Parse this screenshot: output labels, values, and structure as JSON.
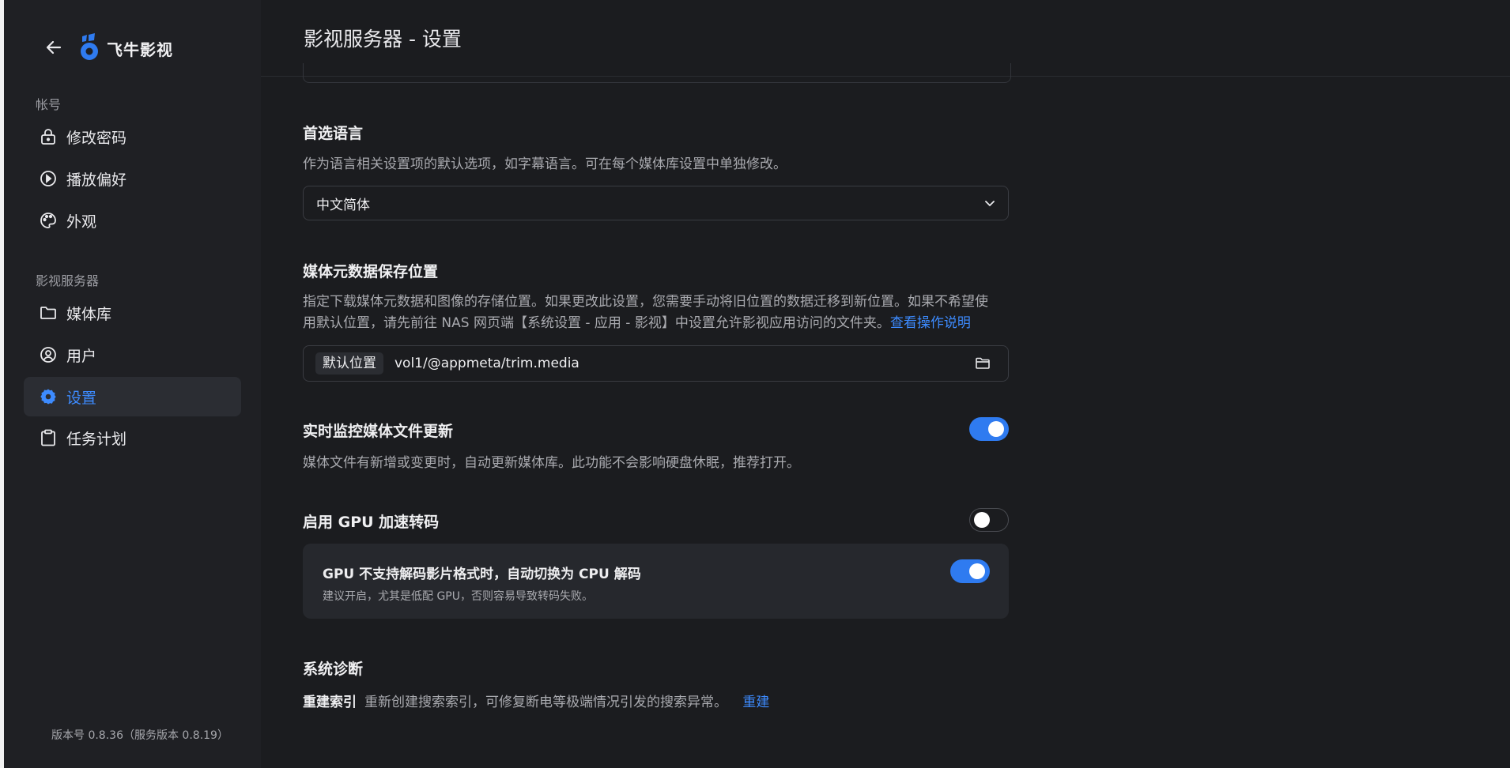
{
  "app": {
    "name": "飞牛影视"
  },
  "header": {
    "title": "影视服务器 - 设置"
  },
  "sidebar": {
    "account_label": "帐号",
    "account_items": [
      {
        "label": "修改密码",
        "icon": "lock-icon"
      },
      {
        "label": "播放偏好",
        "icon": "play-circle-icon"
      },
      {
        "label": "外观",
        "icon": "palette-icon"
      }
    ],
    "server_label": "影视服务器",
    "server_items": [
      {
        "label": "媒体库",
        "icon": "folder-icon"
      },
      {
        "label": "用户",
        "icon": "user-circle-icon"
      },
      {
        "label": "设置",
        "icon": "gear-icon",
        "active": true
      },
      {
        "label": "任务计划",
        "icon": "clipboard-icon"
      }
    ],
    "version": "版本号 0.8.36（服务版本 0.8.19）"
  },
  "language": {
    "title": "首选语言",
    "desc": "作为语言相关设置项的默认选项，如字幕语言。可在每个媒体库设置中单独修改。",
    "selected": "中文简体"
  },
  "metadata": {
    "title": "媒体元数据保存位置",
    "desc_line1": "指定下载媒体元数据和图像的存储位置。如果更改此设置，您需要手动将旧位置的数据迁移到新位置。如果不希望使",
    "desc_line2": "用默认位置，请先前往 NAS 网页端【系统设置 - 应用 - 影视】中设置允许影视应用访问的文件夹。",
    "link": "查看操作说明",
    "tag": "默认位置",
    "path": "vol1/@appmeta/trim.media"
  },
  "monitor": {
    "title": "实时监控媒体文件更新",
    "desc": "媒体文件有新增或变更时，自动更新媒体库。此功能不会影响硬盘休眠，推荐打开。",
    "enabled": true
  },
  "gpu": {
    "title": "启用 GPU 加速转码",
    "enabled": false,
    "fallback_title": "GPU 不支持解码影片格式时，自动切换为 CPU 解码",
    "fallback_desc": "建议开启，尤其是低配 GPU，否则容易导致转码失败。",
    "fallback_enabled": true
  },
  "diagnostics": {
    "title": "系统诊断",
    "rebuild_label": "重建索引",
    "rebuild_desc": "重新创建搜索索引，可修复断电等极端情况引发的搜索异常。",
    "rebuild_action": "重建"
  },
  "colors": {
    "accent": "#3d8bff",
    "toggle_on": "#2f7bf0",
    "bg": "#1b1c1f",
    "sidebar_bg": "#1f2024"
  }
}
